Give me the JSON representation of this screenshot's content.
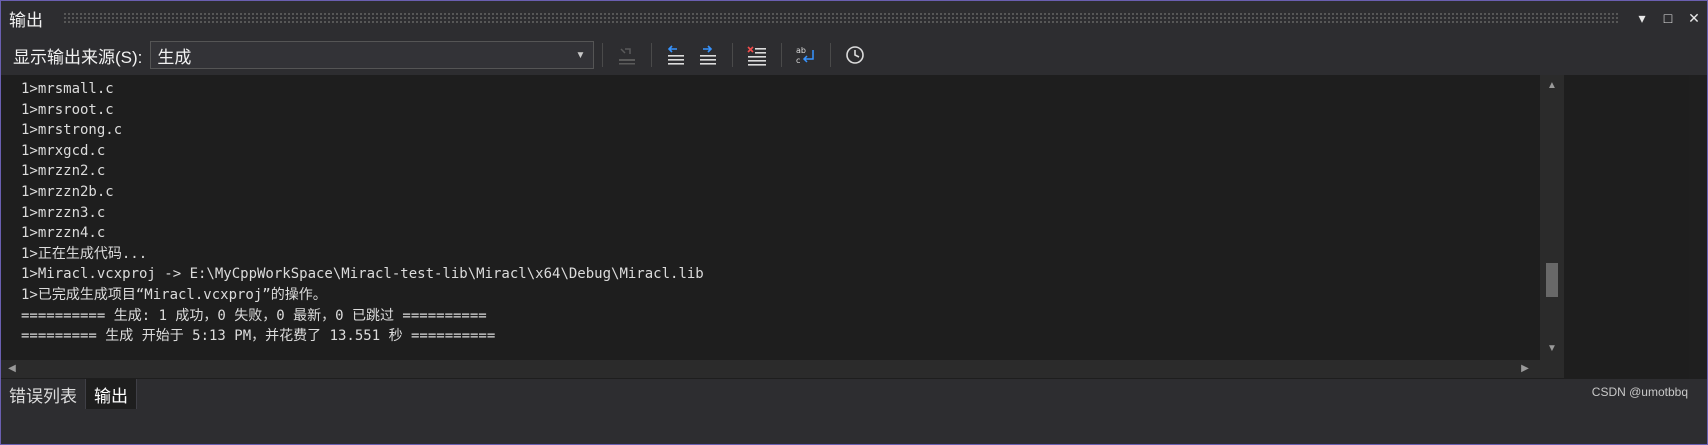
{
  "panel": {
    "title": "输出"
  },
  "window_controls": {
    "dropdown": "▾",
    "maximize": "□",
    "close": "✕"
  },
  "toolbar": {
    "source_label": "显示输出来源(S):",
    "source_value": "生成"
  },
  "output": {
    "lines": [
      "1>mrsmall.c",
      "1>mrsroot.c",
      "1>mrstrong.c",
      "1>mrxgcd.c",
      "1>mrzzn2.c",
      "1>mrzzn2b.c",
      "1>mrzzn3.c",
      "1>mrzzn4.c",
      "1>正在生成代码...",
      "1>Miracl.vcxproj -> E:\\MyCppWorkSpace\\Miracl-test-lib\\Miracl\\x64\\Debug\\Miracl.lib",
      "1>已完成生成项目“Miracl.vcxproj”的操作。",
      "========== 生成: 1 成功，0 失败，0 最新，0 已跳过 ==========",
      "========= 生成 开始于 5:13 PM，并花费了 13.551 秒 =========="
    ]
  },
  "tabs": [
    {
      "label": "错误列表",
      "active": false
    },
    {
      "label": "输出",
      "active": true
    }
  ],
  "watermark": "CSDN @umotbbq",
  "colors": {
    "background": "#1e1e1e",
    "chrome": "#2d2d30",
    "text": "#dcdcdc",
    "accent_blue": "#3794ff",
    "accent_red": "#f14c4c"
  }
}
